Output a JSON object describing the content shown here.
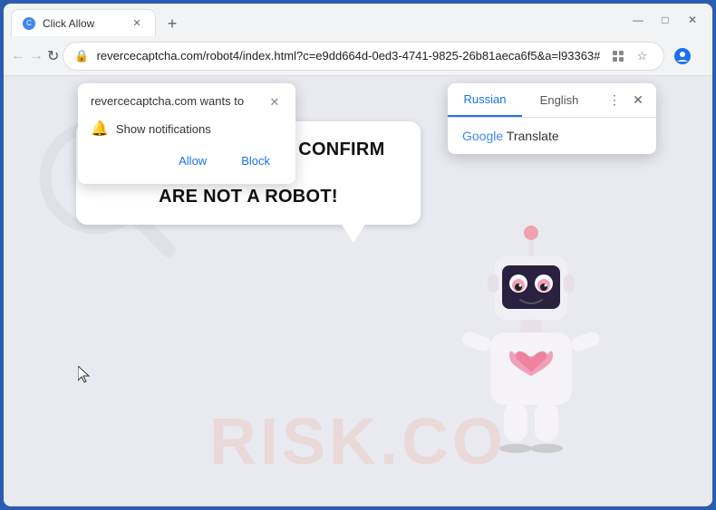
{
  "browser": {
    "tab": {
      "title": "Click Allow",
      "favicon": "C"
    },
    "window_controls": {
      "minimize": "—",
      "maximize": "□",
      "close": "✕"
    },
    "nav": {
      "back": "←",
      "forward": "→",
      "reload": "↻",
      "address": "revercecaptcha.com/robot4/index.html?c=e9dd664d-0ed3-4741-9825-26b81aeca6f5&a=l93363#",
      "bookmark": "☆",
      "profile": "👤",
      "menu": "⋮"
    }
  },
  "notification_popup": {
    "title": "revercecaptcha.com wants to",
    "close_btn": "✕",
    "notification_label": "Show notifications",
    "allow_btn": "Allow",
    "block_btn": "Block"
  },
  "translate_popup": {
    "tab_russian": "Russian",
    "tab_english": "English",
    "more_icon": "⋮",
    "close_icon": "✕",
    "google_text": "Google",
    "translate_text": "Translate"
  },
  "page": {
    "speech_text_line1": "CLICK «ALLOW» TO CONFIRM THAT YOU",
    "speech_text_line2": "ARE NOT A ROBOT!",
    "watermark": "RISK.CO"
  }
}
